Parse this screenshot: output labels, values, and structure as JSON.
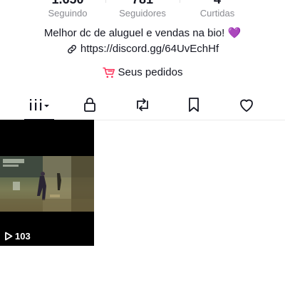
{
  "stats": [
    {
      "value": "1.650",
      "label": "Seguindo"
    },
    {
      "value": "781",
      "label": "Seguidores"
    },
    {
      "value": "4",
      "label": "Curtidas"
    }
  ],
  "bio": {
    "text": "Melhor dc de aluguel e vendas na bio!",
    "emoji": "💜",
    "link": "https://discord.gg/64UvEchHf"
  },
  "orders": {
    "label": "Seus pedidos",
    "icon": "cart-icon",
    "icon_color": "#fe2c55"
  },
  "tabs": [
    {
      "name": "videos-tab",
      "icon": "grid-icon"
    },
    {
      "name": "private-tab",
      "icon": "lock-icon"
    },
    {
      "name": "reposts-tab",
      "icon": "repost-icon"
    },
    {
      "name": "favorites-tab",
      "icon": "bookmark-icon"
    },
    {
      "name": "liked-tab",
      "icon": "heart-icon"
    }
  ],
  "videos": [
    {
      "views": "103",
      "icon": "play-icon"
    }
  ]
}
